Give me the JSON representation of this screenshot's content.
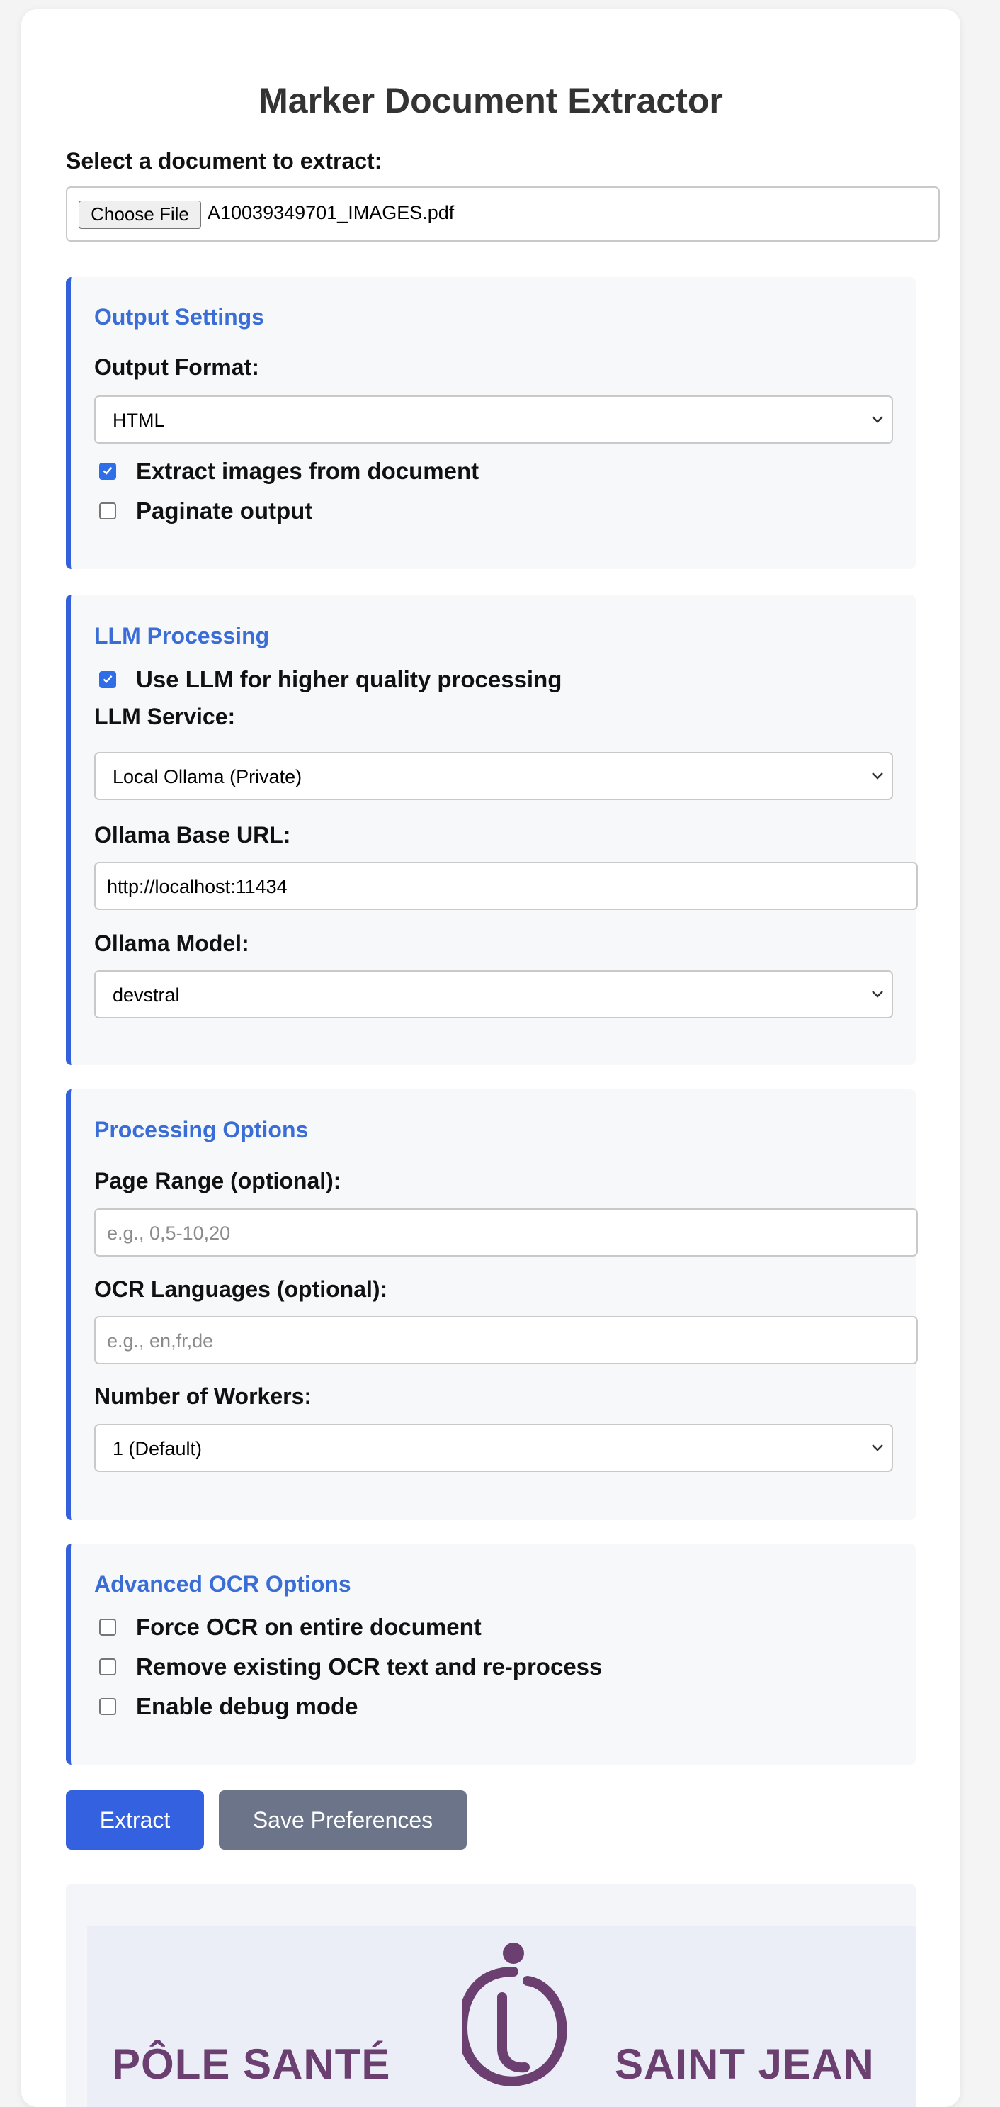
{
  "app": {
    "title": "Marker Document Extractor"
  },
  "file": {
    "label": "Select a document to extract:",
    "button_label": "Choose File",
    "filename": "A10039349701_IMAGES.pdf"
  },
  "output_settings": {
    "title": "Output Settings",
    "format_label": "Output Format:",
    "format_value": "HTML",
    "extract_images_label": "Extract images from document",
    "extract_images_checked": true,
    "paginate_label": "Paginate output",
    "paginate_checked": false
  },
  "llm_processing": {
    "title": "LLM Processing",
    "use_llm_label": "Use LLM for higher quality processing",
    "use_llm_checked": true,
    "service_label": "LLM Service:",
    "service_value": "Local Ollama (Private)",
    "base_url_label": "Ollama Base URL:",
    "base_url_value": "http://localhost:11434",
    "model_label": "Ollama Model:",
    "model_value": "devstral"
  },
  "processing_options": {
    "title": "Processing Options",
    "page_range_label": "Page Range (optional):",
    "page_range_placeholder": "e.g., 0,5-10,20",
    "ocr_languages_label": "OCR Languages (optional):",
    "ocr_languages_placeholder": "e.g., en,fr,de",
    "workers_label": "Number of Workers:",
    "workers_value": "1 (Default)"
  },
  "advanced_ocr": {
    "title": "Advanced OCR Options",
    "force_ocr_label": "Force OCR on entire document",
    "force_ocr_checked": false,
    "remove_ocr_label": "Remove existing OCR text and re-process",
    "remove_ocr_checked": false,
    "debug_label": "Enable debug mode",
    "debug_checked": false
  },
  "actions": {
    "extract_label": "Extract",
    "save_preferences_label": "Save Preferences"
  },
  "preview": {
    "logo_left_text": "PÔLE SANTÉ",
    "logo_right_text": "SAINT JEAN"
  },
  "colors": {
    "accent": "#3461db",
    "section_title": "#3a6ed6",
    "secondary_button": "#6b7489",
    "logo": "#6b3f70"
  },
  "icons": {
    "select_chevron": "chevron-down-icon",
    "checkbox_check": "check-icon",
    "logo_mark": "pole-sante-logo-icon"
  }
}
